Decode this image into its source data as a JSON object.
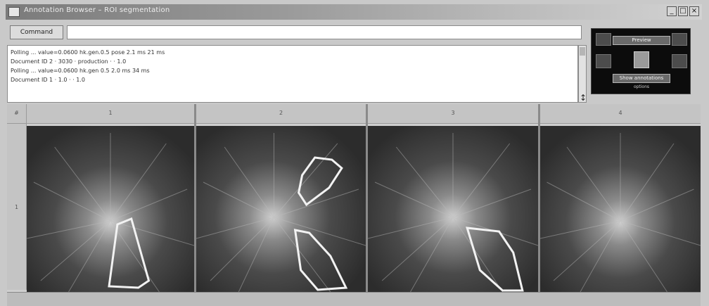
{
  "window": {
    "title": "Annotation Browser – ROI segmentation",
    "icon": "app-icon",
    "controls": [
      "_",
      "□",
      "×"
    ]
  },
  "command": {
    "label": "Command",
    "value": ""
  },
  "log": {
    "lines": [
      "Polling ...  value=0.0600  hk.gen.0.5  pose 2.1 ms  21 ms",
      "Document ID 2 · 3030  · production ·  ·  1.0",
      "Polling ...  value=0.0600  hk.gen  0.5  2.0 ms  34 ms",
      "Document ID 1 · 1.0 ·  ·  1.0"
    ]
  },
  "navigator": {
    "top_button": "Preview",
    "bottom_button": "Show annotations",
    "sub_label": "options"
  },
  "grid": {
    "corner": "#",
    "columns": [
      "1",
      "2",
      "3",
      "4"
    ],
    "row_label": "1"
  },
  "colors": {
    "background": "#c9c9c9",
    "cell_bg": "#3e3e3e",
    "roi_stroke": "#f2f2f2"
  },
  "icons": {
    "minimize": "minimize-icon",
    "maximize": "maximize-icon",
    "close": "close-icon",
    "resize": "resize-handle-icon"
  }
}
